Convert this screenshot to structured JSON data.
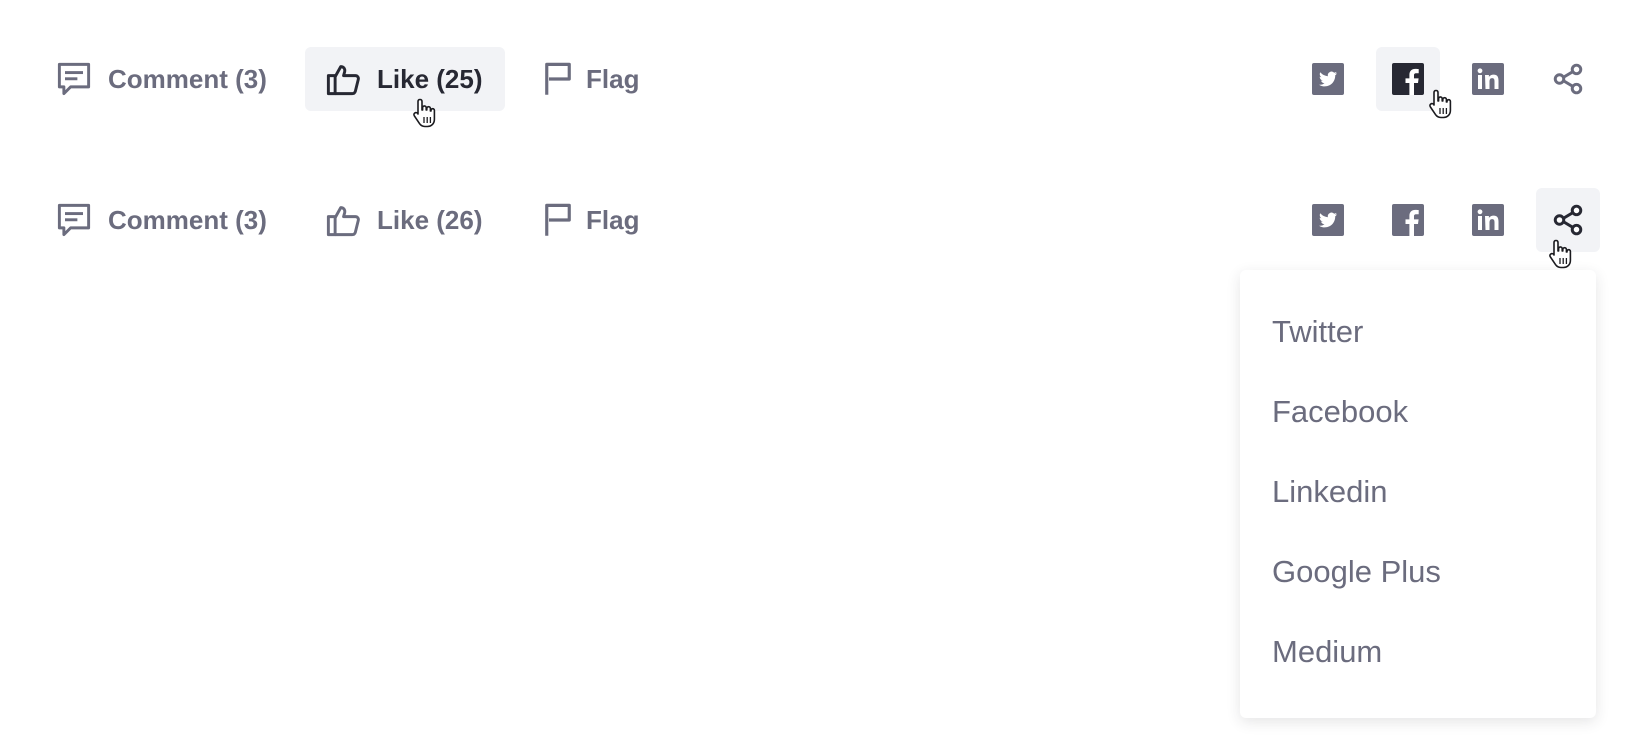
{
  "row1": {
    "comment_label": "Comment (3)",
    "like_label": "Like (25)",
    "flag_label": "Flag"
  },
  "row2": {
    "comment_label": "Comment (3)",
    "like_label": "Like (26)",
    "flag_label": "Flag"
  },
  "icons": {
    "comment": "comment-icon",
    "like": "thumbs-up-icon",
    "flag": "flag-icon",
    "twitter": "twitter-icon",
    "facebook": "facebook-icon",
    "linkedin": "linkedin-icon",
    "share": "share-icon",
    "cursor": "hand-pointer-cursor"
  },
  "share_menu": {
    "items": [
      {
        "label": "Twitter"
      },
      {
        "label": "Facebook"
      },
      {
        "label": "Linkedin"
      },
      {
        "label": "Google Plus"
      },
      {
        "label": "Medium"
      }
    ]
  },
  "colors": {
    "text_muted": "#6b6c7e",
    "text_active": "#272833",
    "hover_bg": "#f2f3f6"
  }
}
